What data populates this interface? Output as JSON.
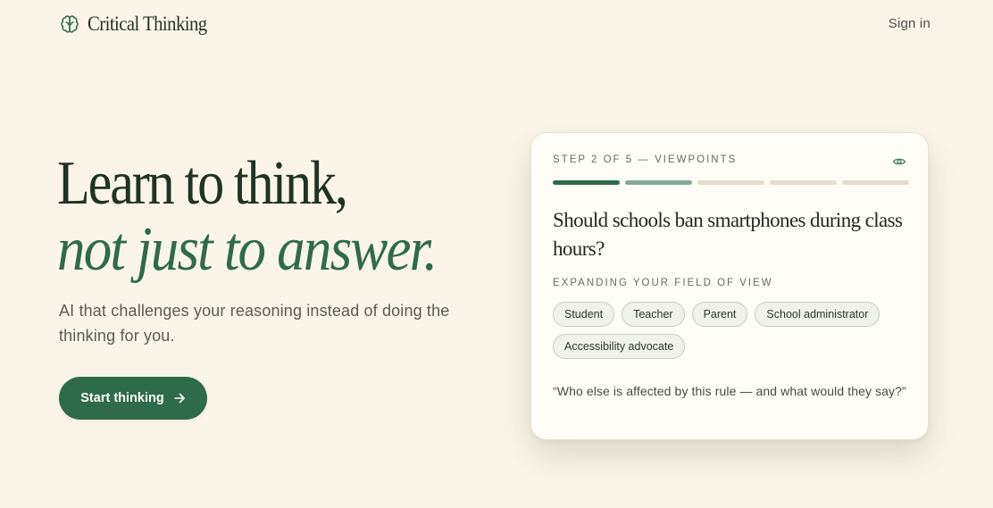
{
  "header": {
    "brand_name": "Critical Thinking",
    "brand_icon": "brain-icon",
    "sign_in_label": "Sign in"
  },
  "hero": {
    "line1": "Learn to think,",
    "line2": "not just to answer.",
    "subtitle": "AI that challenges your reasoning instead of doing the thinking for you.",
    "cta_label": "Start thinking",
    "cta_icon": "arrow-right-icon"
  },
  "card": {
    "step_label": "STEP 2 OF 5 — VIEWPOINTS",
    "eye_icon": "eye-icon",
    "progress": {
      "total_steps": 5,
      "current_step": 2
    },
    "question": "Should schools ban smartphones during class hours?",
    "section_label": "EXPANDING YOUR FIELD OF VIEW",
    "chips": [
      "Student",
      "Teacher",
      "Parent",
      "School administrator",
      "Accessibility advocate"
    ],
    "quote": "“Who else is affected by this rule — and what would they say?”"
  },
  "colors": {
    "background": "#fbf5e9",
    "accent": "#2e6b4a",
    "accent_light": "#84a994",
    "heading": "#203324"
  }
}
